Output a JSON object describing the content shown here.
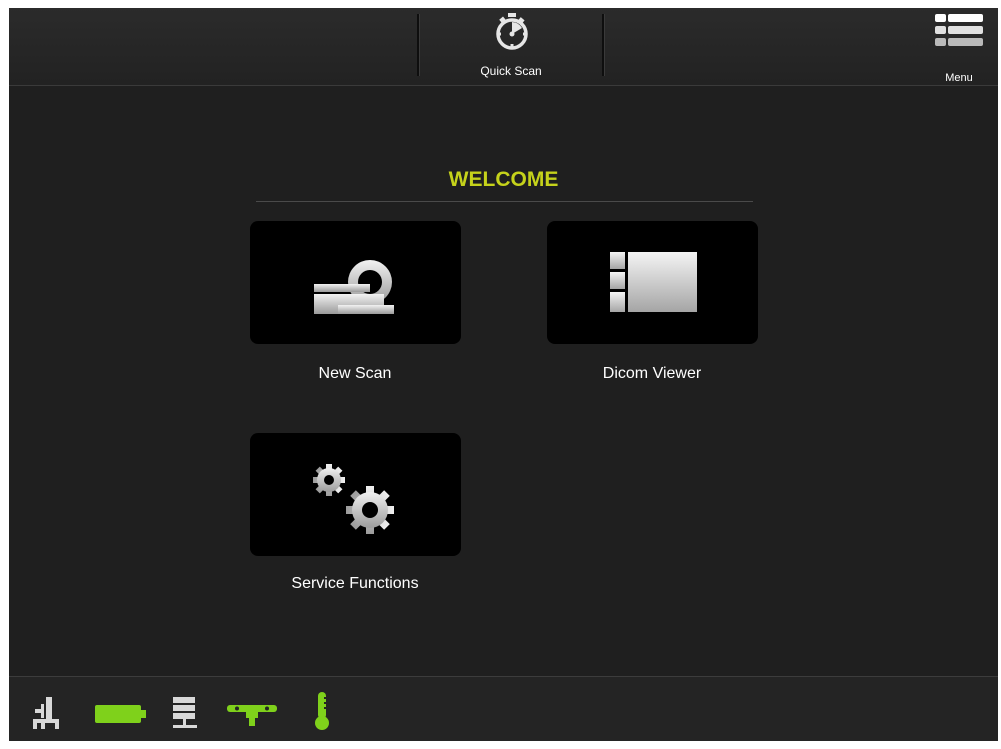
{
  "toolbar": {
    "quick_scan_label": "Quick Scan",
    "quick_scan_icon": "stopwatch-icon",
    "menu_label": "Menu",
    "menu_icon": "menu-list-icon"
  },
  "main": {
    "title": "WELCOME",
    "title_color": "#c5d21b",
    "tiles": [
      {
        "label": "New Scan",
        "icon": "ct-scanner-icon"
      },
      {
        "label": "Dicom Viewer",
        "icon": "image-viewer-icon"
      },
      {
        "label": "Service Functions",
        "icon": "gears-icon"
      }
    ]
  },
  "status_bar": {
    "icons": [
      {
        "name": "gantry-position-icon",
        "color": "#d8d8d8"
      },
      {
        "name": "battery-icon",
        "color": "#7fd11b"
      },
      {
        "name": "server-network-icon",
        "color": "#d8d8d8"
      },
      {
        "name": "cooling-pipe-icon",
        "color": "#7fd11b"
      },
      {
        "name": "thermometer-icon",
        "color": "#7fd11b"
      }
    ]
  }
}
